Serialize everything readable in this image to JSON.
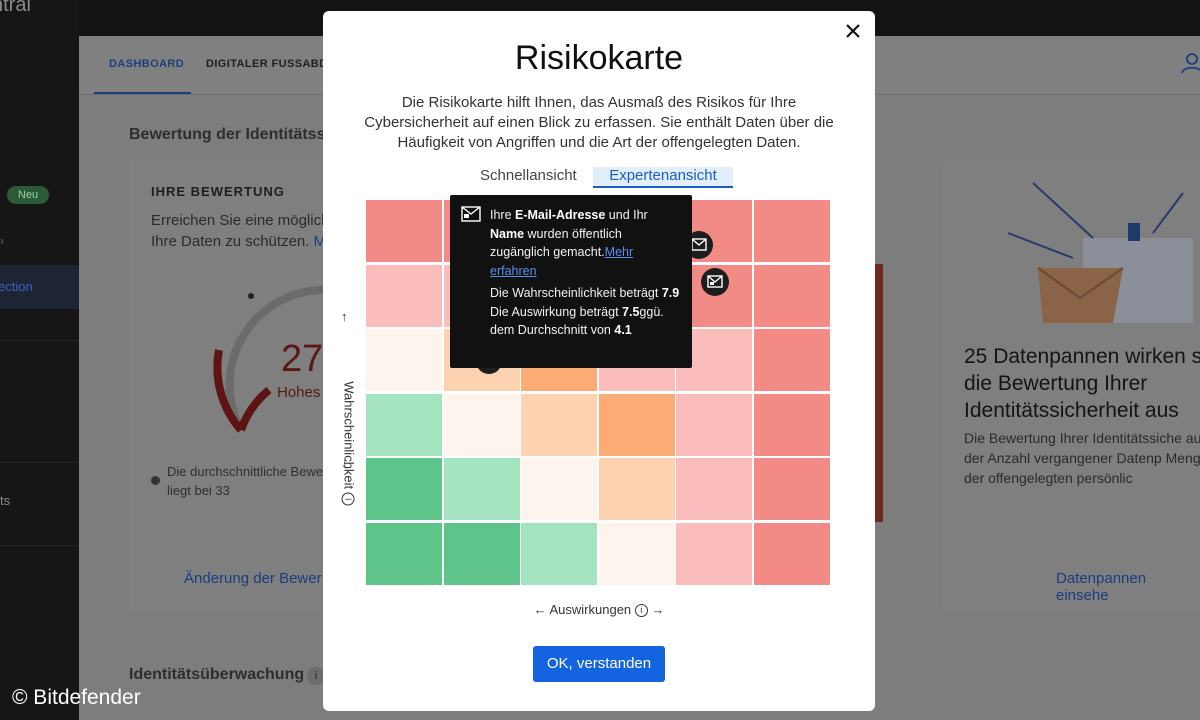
{
  "sidebar": {
    "brand": "ntral",
    "badge": "Neu",
    "selected_item": "ection",
    "item_ts": "ts"
  },
  "tabs": [
    {
      "label": "DASHBOARD"
    },
    {
      "label": "DIGITALER FUSSABDR"
    }
  ],
  "background": {
    "heading_1": "Bewertung der Identitätssi",
    "heading_2": "Identitätsüberwachung",
    "card_label": "IHRE BEWERTUNG",
    "card_text_1": "Erreichen Sie eine möglich",
    "card_text_2": "Ihre Daten zu schützen.",
    "card_link": "M",
    "score": "27",
    "score_label": "Hohes",
    "avg_text_1": "Die durchschnittliche Bewe",
    "avg_text_2": "liegt bei 33",
    "change_link": "Änderung der Bewer",
    "right_title": "25 Datenpannen wirken s die Bewertung Ihrer Identitätssicherheit aus",
    "right_text": "Die Bewertung Ihrer Identitätssiche aus der Anzahl vergangener Datenp Menge der offengelegten persönlic",
    "right_link": "Datenpannen einsehe"
  },
  "watermark": "© Bitdefender",
  "modal": {
    "title": "Risikokarte",
    "description": "Die Risikokarte hilft Ihnen, das Ausmaß des Risikos für Ihre Cybersicherheit auf einen Blick zu erfassen. Sie enthält Daten über die Häufigkeit von Angriffen und die Art der offengelegten Daten.",
    "view_tabs": {
      "quick": "Schnellansicht",
      "expert": "Expertenansicht",
      "active": "expert"
    },
    "y_axis_label": "Wahrscheinlichkeit",
    "x_axis_label": "Auswirkungen",
    "ok_button": "OK, verstanden",
    "tooltip": {
      "line1_pre": "Ihre ",
      "line1_bold": "E-Mail-Adresse",
      "line1_post": " und Ihr",
      "line2_bold": "Name",
      "line2_post": " wurden öffentlich zugänglich gemacht.",
      "link": "Mehr erfahren",
      "prob_text": "Die Wahrscheinlichkeit beträgt",
      "prob_value": "7.9",
      "impact_text": "Die Auswirkung beträgt",
      "impact_value": "7.5",
      "avg_text": "ggü. dem Durchschnitt von",
      "avg_value": "4.1"
    },
    "heatmap": {
      "rows": 6,
      "cols": 6,
      "colors": {
        "red": "#f28b86",
        "pink": "#fbbcbc",
        "cream": "#fdf4ee",
        "peach": "#fdd2b0",
        "orange": "#fbab73",
        "lightgreen": "#a3e3bf",
        "green": "#5ec58a"
      },
      "cells": [
        [
          "red",
          "red",
          "red",
          "red",
          "red",
          "red"
        ],
        [
          "pink",
          "pink",
          "pink",
          "pink",
          "red",
          "red"
        ],
        [
          "cream",
          "peach",
          "orange",
          "pink",
          "pink",
          "red"
        ],
        [
          "lightgreen",
          "cream",
          "peach",
          "orange",
          "pink",
          "red"
        ],
        [
          "green",
          "lightgreen",
          "cream",
          "peach",
          "pink",
          "red"
        ],
        [
          "green",
          "green",
          "lightgreen",
          "cream",
          "pink",
          "red"
        ]
      ]
    }
  }
}
